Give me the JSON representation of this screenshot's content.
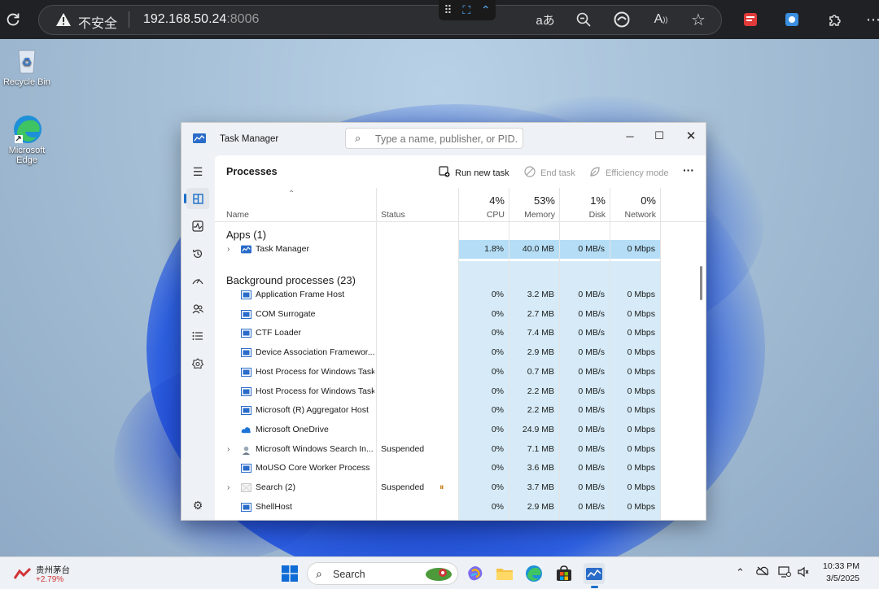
{
  "browser": {
    "security_label": "不安全",
    "url_host": "192.168.50.24",
    "url_port": ":8006"
  },
  "desktop": {
    "icons": [
      {
        "label": "Recycle Bin"
      },
      {
        "label": "Microsoft Edge"
      }
    ]
  },
  "task_manager": {
    "title": "Task Manager",
    "search_placeholder": "Type a name, publisher, or PID...",
    "page_title": "Processes",
    "toolbar": {
      "run_new_task": "Run new task",
      "end_task": "End task",
      "efficiency_mode": "Efficiency mode",
      "more": "···"
    },
    "columns": {
      "name": "Name",
      "status": "Status",
      "cpu_pct": "4%",
      "cpu": "CPU",
      "memory_pct": "53%",
      "memory": "Memory",
      "disk_pct": "1%",
      "disk": "Disk",
      "network_pct": "0%",
      "network": "Network"
    },
    "apps_header": "Apps (1)",
    "apps": [
      {
        "name": "Task Manager",
        "status": "",
        "cpu": "1.8%",
        "memory": "40.0 MB",
        "disk": "0 MB/s",
        "network": "0 Mbps",
        "expandable": true,
        "icon": "task-manager-icon"
      }
    ],
    "bg_header": "Background processes (23)",
    "background": [
      {
        "name": "Application Frame Host",
        "status": "",
        "cpu": "0%",
        "memory": "3.2 MB",
        "disk": "0 MB/s",
        "network": "0 Mbps",
        "expandable": false,
        "icon": "app-window-icon"
      },
      {
        "name": "COM Surrogate",
        "status": "",
        "cpu": "0%",
        "memory": "2.7 MB",
        "disk": "0 MB/s",
        "network": "0 Mbps",
        "expandable": false,
        "icon": "app-window-icon"
      },
      {
        "name": "CTF Loader",
        "status": "",
        "cpu": "0%",
        "memory": "7.4 MB",
        "disk": "0 MB/s",
        "network": "0 Mbps",
        "expandable": false,
        "icon": "app-window-icon"
      },
      {
        "name": "Device Association Framewor...",
        "status": "",
        "cpu": "0%",
        "memory": "2.9 MB",
        "disk": "0 MB/s",
        "network": "0 Mbps",
        "expandable": false,
        "icon": "app-window-icon"
      },
      {
        "name": "Host Process for Windows Tasks",
        "status": "",
        "cpu": "0%",
        "memory": "0.7 MB",
        "disk": "0 MB/s",
        "network": "0 Mbps",
        "expandable": false,
        "icon": "app-window-icon"
      },
      {
        "name": "Host Process for Windows Tasks",
        "status": "",
        "cpu": "0%",
        "memory": "2.2 MB",
        "disk": "0 MB/s",
        "network": "0 Mbps",
        "expandable": false,
        "icon": "app-window-icon"
      },
      {
        "name": "Microsoft (R) Aggregator Host",
        "status": "",
        "cpu": "0%",
        "memory": "2.2 MB",
        "disk": "0 MB/s",
        "network": "0 Mbps",
        "expandable": false,
        "icon": "app-window-icon"
      },
      {
        "name": "Microsoft OneDrive",
        "status": "",
        "cpu": "0%",
        "memory": "24.9 MB",
        "disk": "0 MB/s",
        "network": "0 Mbps",
        "expandable": false,
        "icon": "onedrive-cloud-icon"
      },
      {
        "name": "Microsoft Windows Search In...",
        "status": "Suspended",
        "cpu": "0%",
        "memory": "7.1 MB",
        "disk": "0 MB/s",
        "network": "0 Mbps",
        "expandable": true,
        "icon": "search-indexer-icon"
      },
      {
        "name": "MoUSO Core Worker Process",
        "status": "",
        "cpu": "0%",
        "memory": "3.6 MB",
        "disk": "0 MB/s",
        "network": "0 Mbps",
        "expandable": false,
        "icon": "app-window-icon"
      },
      {
        "name": "Search (2)",
        "status": "Suspended",
        "cpu": "0%",
        "memory": "3.7 MB",
        "disk": "0 MB/s",
        "network": "0 Mbps",
        "expandable": true,
        "icon": "search-process-icon",
        "paused_icon": true
      },
      {
        "name": "ShellHost",
        "status": "",
        "cpu": "0%",
        "memory": "2.9 MB",
        "disk": "0 MB/s",
        "network": "0 Mbps",
        "expandable": false,
        "icon": "app-window-icon"
      }
    ]
  },
  "taskbar": {
    "stock_name": "贵州茅台",
    "stock_change": "+2.79%",
    "search_label": "Search",
    "time": "10:33 PM",
    "date": "3/5/2025"
  },
  "colors": {
    "accent": "#1a6fc9",
    "heat_light": "#d6ebf7",
    "heat_strong": "#b5def6",
    "stock_up": "#d13438"
  }
}
